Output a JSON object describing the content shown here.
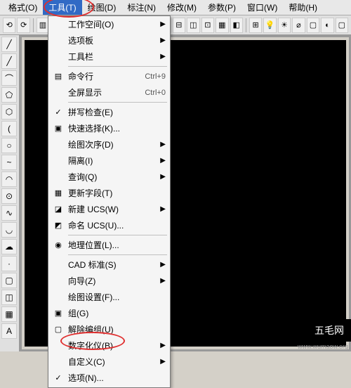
{
  "menubar": {
    "items": [
      {
        "label": "格式(O)"
      },
      {
        "label": "工具(T)"
      },
      {
        "label": "绘图(D)"
      },
      {
        "label": "标注(N)"
      },
      {
        "label": "修改(M)"
      },
      {
        "label": "参数(P)"
      },
      {
        "label": "窗口(W)"
      },
      {
        "label": "帮助(H)"
      }
    ]
  },
  "toolbar": {
    "left_icons": [
      "⟲",
      "⟳",
      "▥",
      "◫"
    ],
    "right_icons": [
      "📄",
      "⊞",
      "⊟",
      "◫",
      "⊡",
      "▦",
      "◧"
    ],
    "far_icons": [
      "⊞",
      "💡",
      "☀",
      "⌀",
      "▢",
      "◐",
      "▢"
    ]
  },
  "left_tools": [
    "╱",
    "╱",
    "⌒",
    "⬠",
    "⬡",
    "(",
    "○",
    "~",
    "◠",
    "⊙",
    "∿",
    "◡",
    "☁",
    "·",
    "▢",
    "◫",
    "▦",
    "A"
  ],
  "dropdown": {
    "items": [
      {
        "label": "工作空间(O)",
        "submenu": true
      },
      {
        "label": "选项板",
        "submenu": true
      },
      {
        "label": "工具栏",
        "submenu": true
      },
      {
        "sep": true
      },
      {
        "label": "命令行",
        "icon": "▤",
        "shortcut": "Ctrl+9"
      },
      {
        "label": "全屏显示",
        "icon": "",
        "shortcut": "Ctrl+0"
      },
      {
        "sep": true
      },
      {
        "label": "拼写检查(E)",
        "icon": "✓"
      },
      {
        "label": "快速选择(K)...",
        "icon": "▣"
      },
      {
        "label": "绘图次序(D)",
        "submenu": true
      },
      {
        "label": "隔离(I)",
        "submenu": true
      },
      {
        "label": "查询(Q)",
        "submenu": true
      },
      {
        "label": "更新字段(T)",
        "icon": "▦"
      },
      {
        "label": "新建 UCS(W)",
        "icon": "◪",
        "submenu": true
      },
      {
        "label": "命名 UCS(U)...",
        "icon": "◩"
      },
      {
        "sep": true
      },
      {
        "label": "地理位置(L)...",
        "icon": "◉"
      },
      {
        "sep": true
      },
      {
        "label": "CAD 标准(S)",
        "submenu": true
      },
      {
        "label": "向导(Z)",
        "submenu": true
      },
      {
        "label": "绘图设置(F)..."
      },
      {
        "label": "组(G)",
        "icon": "▣"
      },
      {
        "label": "解除编组(U)",
        "icon": "▢"
      },
      {
        "label": "数字化仪(B)",
        "submenu": true
      },
      {
        "label": "自定义(C)",
        "submenu": true
      },
      {
        "label": "选项(N)...",
        "icon": "✓"
      }
    ]
  },
  "watermark": {
    "title": "五毛网",
    "url": "www.wumaow.org"
  }
}
